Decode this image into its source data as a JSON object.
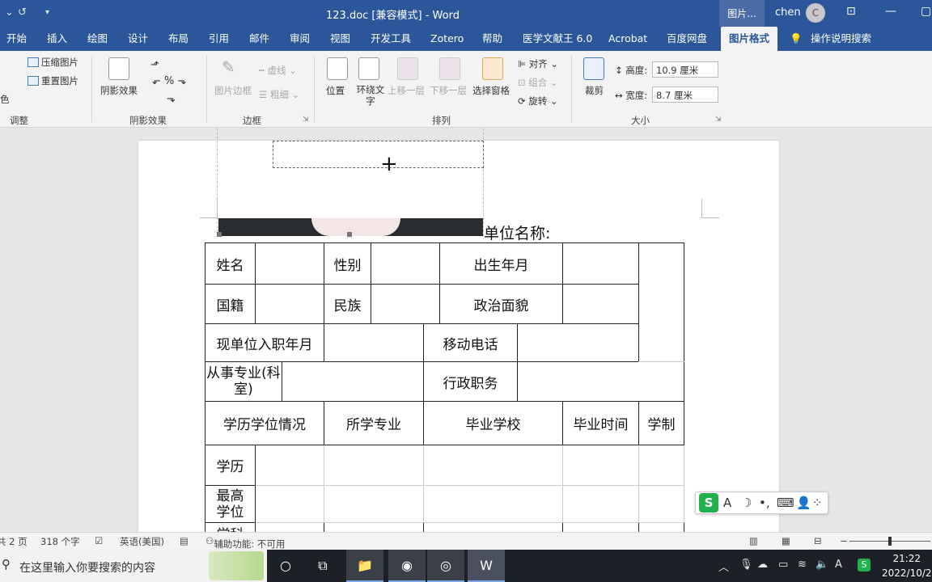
{
  "titlebar": {
    "title": "123.doc [兼容模式]  -  Word",
    "context_tab": "图片...",
    "user": "chen",
    "avatar_initial": "C",
    "undo": "↺",
    "qa_more": "▾",
    "minimize": "—",
    "restore": "▢",
    "ribbon_display": "⊡"
  },
  "tabs": [
    "开始",
    "插入",
    "绘图",
    "设计",
    "布局",
    "引用",
    "邮件",
    "审阅",
    "视图",
    "开发工具",
    "Zotero",
    "帮助",
    "医学文献王 6.0",
    "Acrobat",
    "百度网盘"
  ],
  "active_tab": "图片格式",
  "tell_me": "操作说明搜索",
  "ribbon": {
    "adjust": {
      "compress": "压缩图片",
      "reset": "重置图片",
      "color": "色",
      "label": "调整"
    },
    "shadow": {
      "effects": "阴影效果",
      "label": "阴影效果"
    },
    "border": {
      "picture_border": "图片边框",
      "dashes": "虚线",
      "weight": "粗细",
      "label": "边框"
    },
    "arrange": {
      "position": "位置",
      "wrap_text": "环绕文字",
      "bring_forward": "上移一层",
      "send_backward": "下移一层",
      "selection_pane": "选择窗格",
      "align": "对齐",
      "group": "组合",
      "rotate": "旋转",
      "label": "排列"
    },
    "size": {
      "crop": "裁剪",
      "height_label": "高度:",
      "height_value": "10.9 厘米",
      "width_label": "宽度:",
      "width_value": "8.7 厘米",
      "label": "大小"
    }
  },
  "document": {
    "unit_label": "单位名称:",
    "table": {
      "r1": {
        "c1": "姓名",
        "c2": "性别",
        "c3": "出生年月"
      },
      "r2": {
        "c1": "国籍",
        "c2": "民族",
        "c3": "政治面貌"
      },
      "r3": {
        "c1": "现单位入职年月",
        "c2": "移动电话"
      },
      "r4": {
        "c1": "从事专业(科室)",
        "c2": "行政职务"
      },
      "r5": {
        "c1": "学历学位情况",
        "c2": "所学专业",
        "c3": "毕业学校",
        "c4": "毕业时间",
        "c5": "学制"
      },
      "r6": {
        "c1": "学历"
      },
      "r7": {
        "c1": "最高学位"
      },
      "r8": {
        "c1": "学科"
      }
    }
  },
  "status": {
    "page": "共 2 页",
    "words": "318 个字",
    "language": "英语(美国)",
    "accessibility": "辅助功能: 不可用"
  },
  "ime": {
    "logo": "S",
    "items": [
      "A",
      "☽",
      "•,",
      "⌨",
      "👤",
      "⁘"
    ]
  },
  "taskbar": {
    "search_placeholder": "在这里输入你要搜索的内容",
    "time": "21:22",
    "date": "2022/10/2",
    "lang": "A"
  }
}
